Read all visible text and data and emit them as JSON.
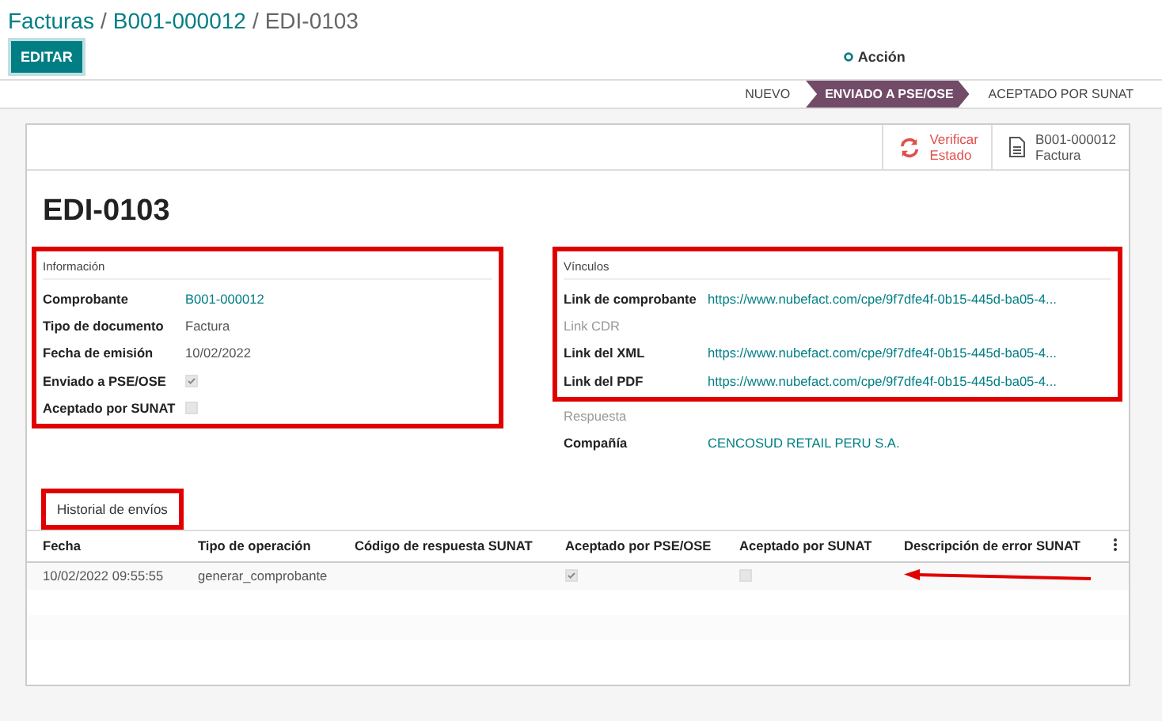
{
  "breadcrumb": [
    {
      "label": "Facturas",
      "kind": "link"
    },
    {
      "label": "B001-000012",
      "kind": "link",
      "separator": "/"
    },
    {
      "label": "EDI-0103",
      "kind": "current",
      "separator": "/"
    }
  ],
  "edit_button": "EDITAR",
  "action_menu": "Acción",
  "statusbar": [
    {
      "label": "NUEVO",
      "selected": false
    },
    {
      "label": "ENVIADO A PSE/OSE",
      "selected": true
    },
    {
      "label": "ACEPTADO POR SUNAT",
      "selected": false
    }
  ],
  "smart_buttons": [
    {
      "kind": "refresh",
      "lines": [
        "Verificar",
        "Estado"
      ]
    },
    {
      "kind": "document",
      "lines": [
        "B001-000012",
        "Factura"
      ]
    }
  ],
  "title": "EDI-0103",
  "left_group": {
    "title": "Información",
    "highlighted": true,
    "fields": [
      {
        "label": "Comprobante",
        "kind": "link",
        "value": "B001-000012"
      },
      {
        "label": "Tipo de documento",
        "kind": "text",
        "value": "Factura"
      },
      {
        "label": "Fecha de emisión",
        "kind": "text",
        "value": "10/02/2022"
      },
      {
        "label": "Enviado a PSE/OSE",
        "kind": "checkbox",
        "checked": true
      },
      {
        "label": "Aceptado por SUNAT",
        "kind": "checkbox",
        "checked": false
      }
    ]
  },
  "right_group": {
    "title": "Vínculos",
    "highlighted": true,
    "fields": [
      {
        "label": "Link de comprobante",
        "kind": "link",
        "value": "https://www.nubefact.com/cpe/9f7dfe4f-0b15-445d-ba05-4..."
      },
      {
        "label": "Link CDR",
        "kind": "empty"
      },
      {
        "label": "Link del XML",
        "kind": "link",
        "value": "https://www.nubefact.com/cpe/9f7dfe4f-0b15-445d-ba05-4..."
      },
      {
        "label": "Link del PDF",
        "kind": "link",
        "value": "https://www.nubefact.com/cpe/9f7dfe4f-0b15-445d-ba05-4..."
      }
    ]
  },
  "extra_fields": [
    {
      "label": "Respuesta",
      "kind": "empty"
    },
    {
      "label": "Compañía",
      "kind": "link",
      "value": "CENCOSUD RETAIL PERU S.A."
    }
  ],
  "tabs": [
    {
      "label": "Historial de envíos",
      "selected": true,
      "highlighted": true
    }
  ],
  "table": {
    "columns": [
      "Fecha",
      "Tipo de operación",
      "Código de respuesta SUNAT",
      "Aceptado por PSE/OSE",
      "Aceptado por SUNAT",
      "Descripción de error SUNAT"
    ],
    "rows": [
      {
        "fecha": "10/02/2022 09:55:55",
        "operacion": "generar_comprobante",
        "pse_checked": true,
        "sunat_checked": false,
        "arrow": true
      }
    ]
  }
}
